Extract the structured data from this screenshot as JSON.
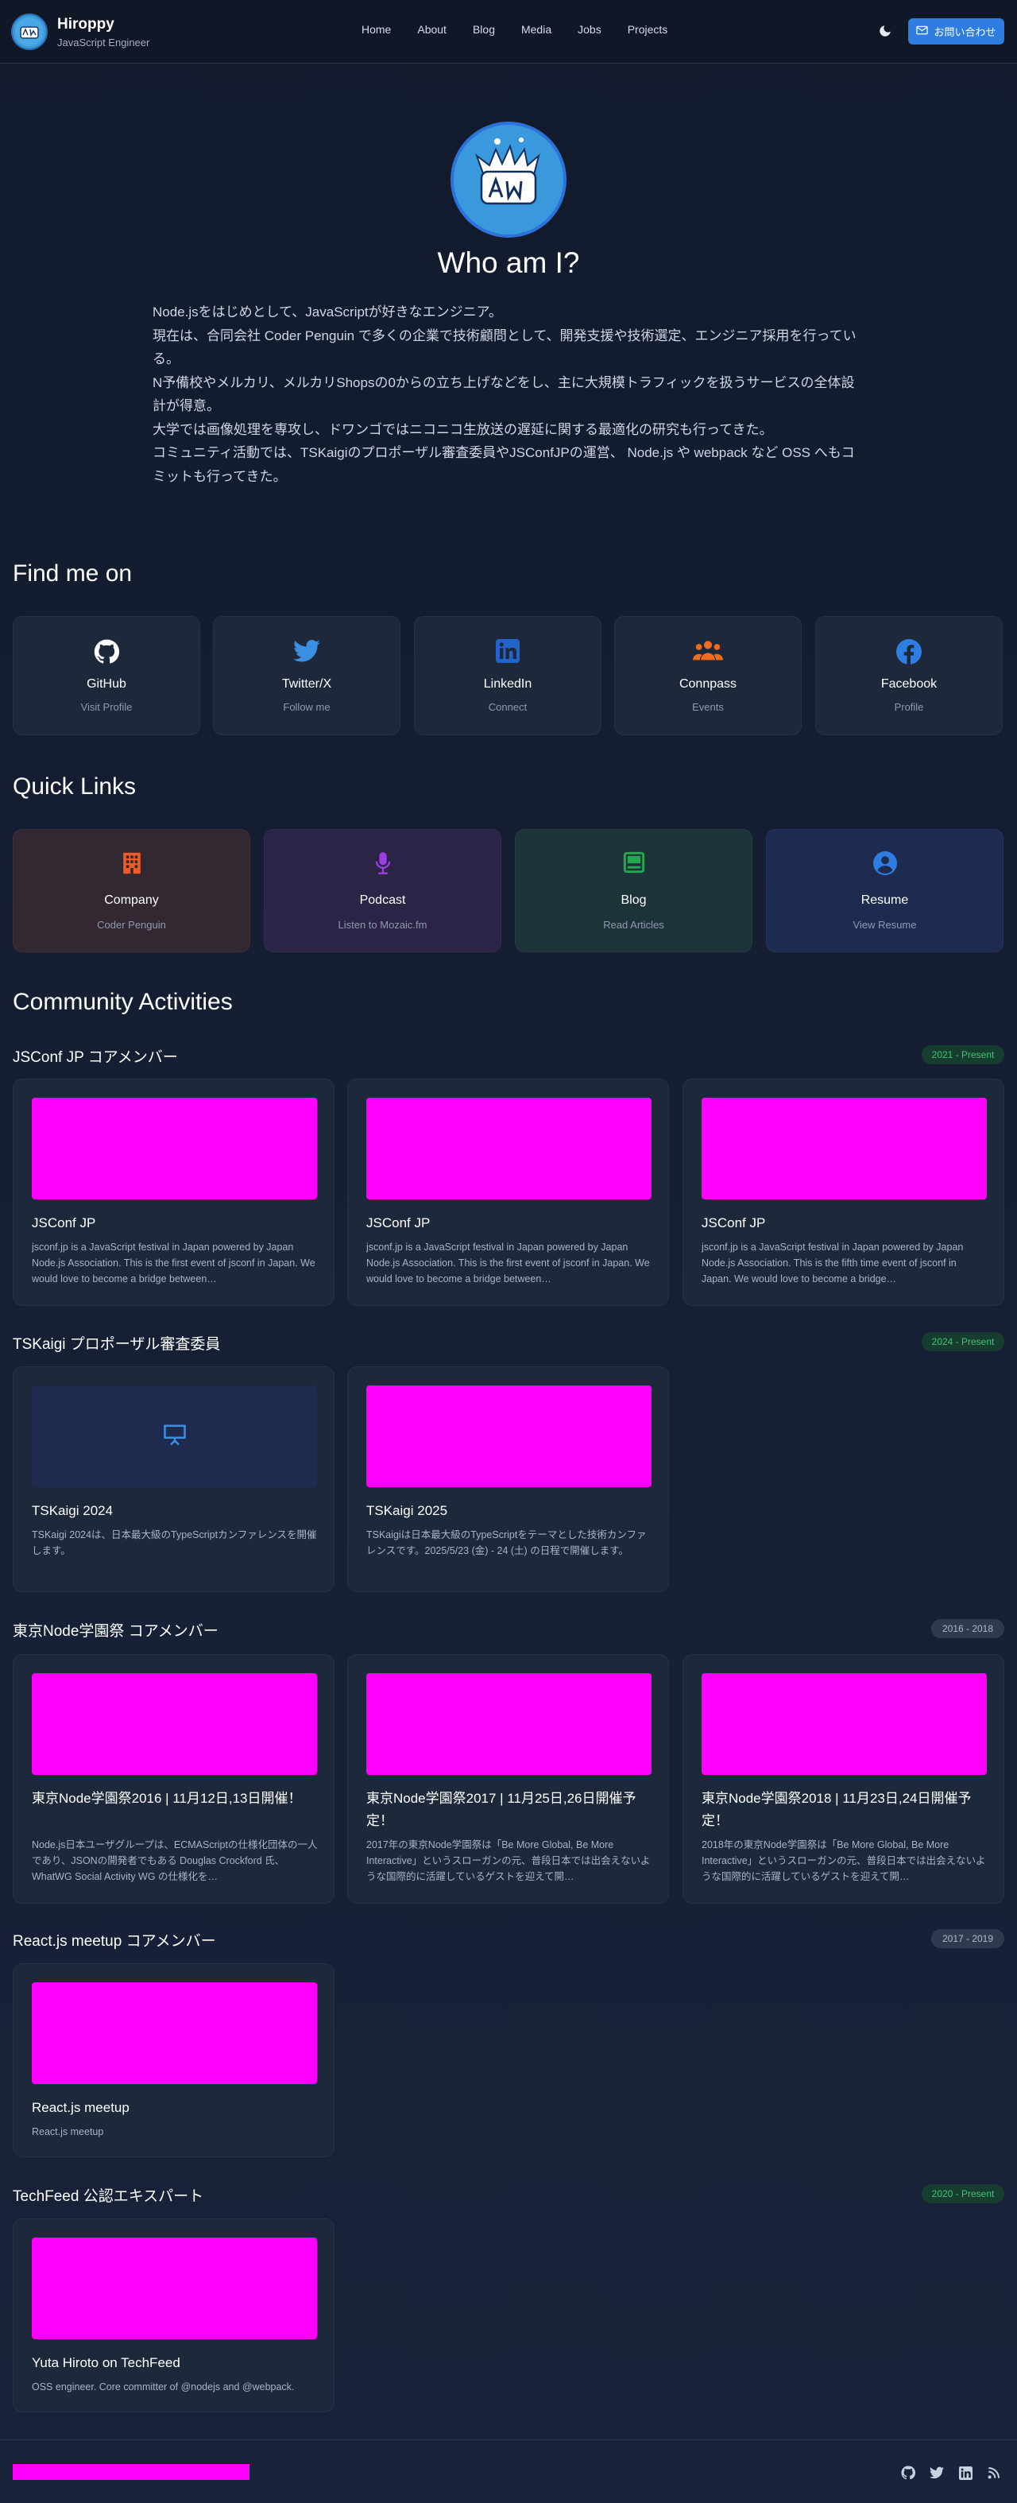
{
  "header": {
    "name": "Hiroppy",
    "role": "JavaScript Engineer",
    "nav": [
      "Home",
      "About",
      "Blog",
      "Media",
      "Jobs",
      "Projects"
    ],
    "contact_label": "お問い合わせ"
  },
  "hero": {
    "title": "Who am I?",
    "bio": [
      "Node.jsをはじめとして、JavaScriptが好きなエンジニア。",
      "現在は、合同会社 Coder Penguin で多くの企業で技術顧問として、開発支援や技術選定、エンジニア採用を行っている。",
      "N予備校やメルカリ、メルカリShopsの0からの立ち上げなどをし、主に大規模トラフィックを扱うサービスの全体設計が得意。",
      "大学では画像処理を専攻し、ドワンゴではニコニコ生放送の遅延に関する最適化の研究も行ってきた。",
      "コミュニティ活動では、TSKaigiのプロポーザル審査委員やJSConfJPの運営、 Node.js や webpack など OSS へもコミットも行ってきた。"
    ]
  },
  "find_me": {
    "title": "Find me on",
    "items": [
      {
        "title": "GitHub",
        "sub": "Visit Profile",
        "icon": "github-icon",
        "color": "#ffffff"
      },
      {
        "title": "Twitter/X",
        "sub": "Follow me",
        "icon": "twitter-icon",
        "color": "#3b8fe3"
      },
      {
        "title": "LinkedIn",
        "sub": "Connect",
        "icon": "linkedin-icon",
        "color": "#2463c9"
      },
      {
        "title": "Connpass",
        "sub": "Events",
        "icon": "people-icon",
        "color": "#ee6c1b"
      },
      {
        "title": "Facebook",
        "sub": "Profile",
        "icon": "facebook-icon",
        "color": "#2f7de1"
      }
    ]
  },
  "quick_links": {
    "title": "Quick Links",
    "items": [
      {
        "title": "Company",
        "sub": "Coder Penguin",
        "icon": "building-icon",
        "color": "#ee5b27",
        "bg": "#332832"
      },
      {
        "title": "Podcast",
        "sub": "Listen to Mozaic.fm",
        "icon": "microphone-icon",
        "color": "#9b3ee3",
        "bg": "#2b2447"
      },
      {
        "title": "Blog",
        "sub": "Read Articles",
        "icon": "article-icon",
        "color": "#26a84f",
        "bg": "#1c3338"
      },
      {
        "title": "Resume",
        "sub": "View Resume",
        "icon": "person-circle-icon",
        "color": "#2f7de1",
        "bg": "#1e2b50"
      }
    ]
  },
  "community": {
    "title": "Community Activities",
    "groups": [
      {
        "title": "JSConf JP コアメンバー",
        "period": "2021 - Present",
        "badge": "green",
        "cards": [
          {
            "title": "JSConf JP",
            "desc": "jsconf.jp is a JavaScript festival in Japan powered by Japan Node.js Association. This is the first event of jsconf in Japan. We would love to become a bridge between…"
          },
          {
            "title": "JSConf JP",
            "desc": "jsconf.jp is a JavaScript festival in Japan powered by Japan Node.js Association. This is the first event of jsconf in Japan. We would love to become a bridge between…"
          },
          {
            "title": "JSConf JP",
            "desc": "jsconf.jp is a JavaScript festival in Japan powered by Japan Node.js Association. This is the fifth time event of jsconf in Japan. We would love to become a bridge…"
          }
        ]
      },
      {
        "title": "TSKaigi プロポーザル審査委員",
        "period": "2024 - Present",
        "badge": "green",
        "cards": [
          {
            "title": "TSKaigi 2024",
            "desc": "TSKaigi 2024は、日本最大級のTypeScriptカンファレンスを開催します。",
            "placeholder": true
          },
          {
            "title": "TSKaigi 2025",
            "desc": "TSKaigiは日本最大級のTypeScriptをテーマとした技術カンファレンスです。2025/5/23 (金) - 24 (土) の日程で開催します。"
          }
        ]
      },
      {
        "title": "東京Node学園祭 コアメンバー",
        "period": "2016 - 2018",
        "badge": "gray",
        "cards": [
          {
            "title": "東京Node学園祭2016 | 11月12日,13日開催！",
            "desc": "Node.js日本ユーザグループは、ECMAScriptの仕様化団体の一人であり、JSONの開発者でもある Douglas Crockford 氏、WhatWG Social Activity WG の仕様化を…"
          },
          {
            "title": "東京Node学園祭2017 | 11月25日,26日開催予定！",
            "desc": "2017年の東京Node学園祭は「Be More Global, Be More Interactive」というスローガンの元、普段日本では出会えないような国際的に活躍しているゲストを迎えて開…"
          },
          {
            "title": "東京Node学園祭2018 | 11月23日,24日開催予定！",
            "desc": "2018年の東京Node学園祭は「Be More Global, Be More Interactive」というスローガンの元、普段日本では出会えないような国際的に活躍しているゲストを迎えて開…"
          }
        ]
      },
      {
        "title": "React.js meetup コアメンバー",
        "period": "2017 - 2019",
        "badge": "gray",
        "cards": [
          {
            "title": "React.js meetup",
            "desc": "React.js meetup"
          }
        ]
      },
      {
        "title": "TechFeed 公認エキスパート",
        "period": "2020 - Present",
        "badge": "green",
        "cards": [
          {
            "title": "Yuta Hiroto on TechFeed",
            "desc": "OSS engineer. Core committer of @nodejs and @webpack."
          }
        ]
      }
    ]
  },
  "footer": {
    "icons": [
      "github-icon",
      "twitter-icon",
      "linkedin-icon",
      "rss-icon"
    ]
  }
}
